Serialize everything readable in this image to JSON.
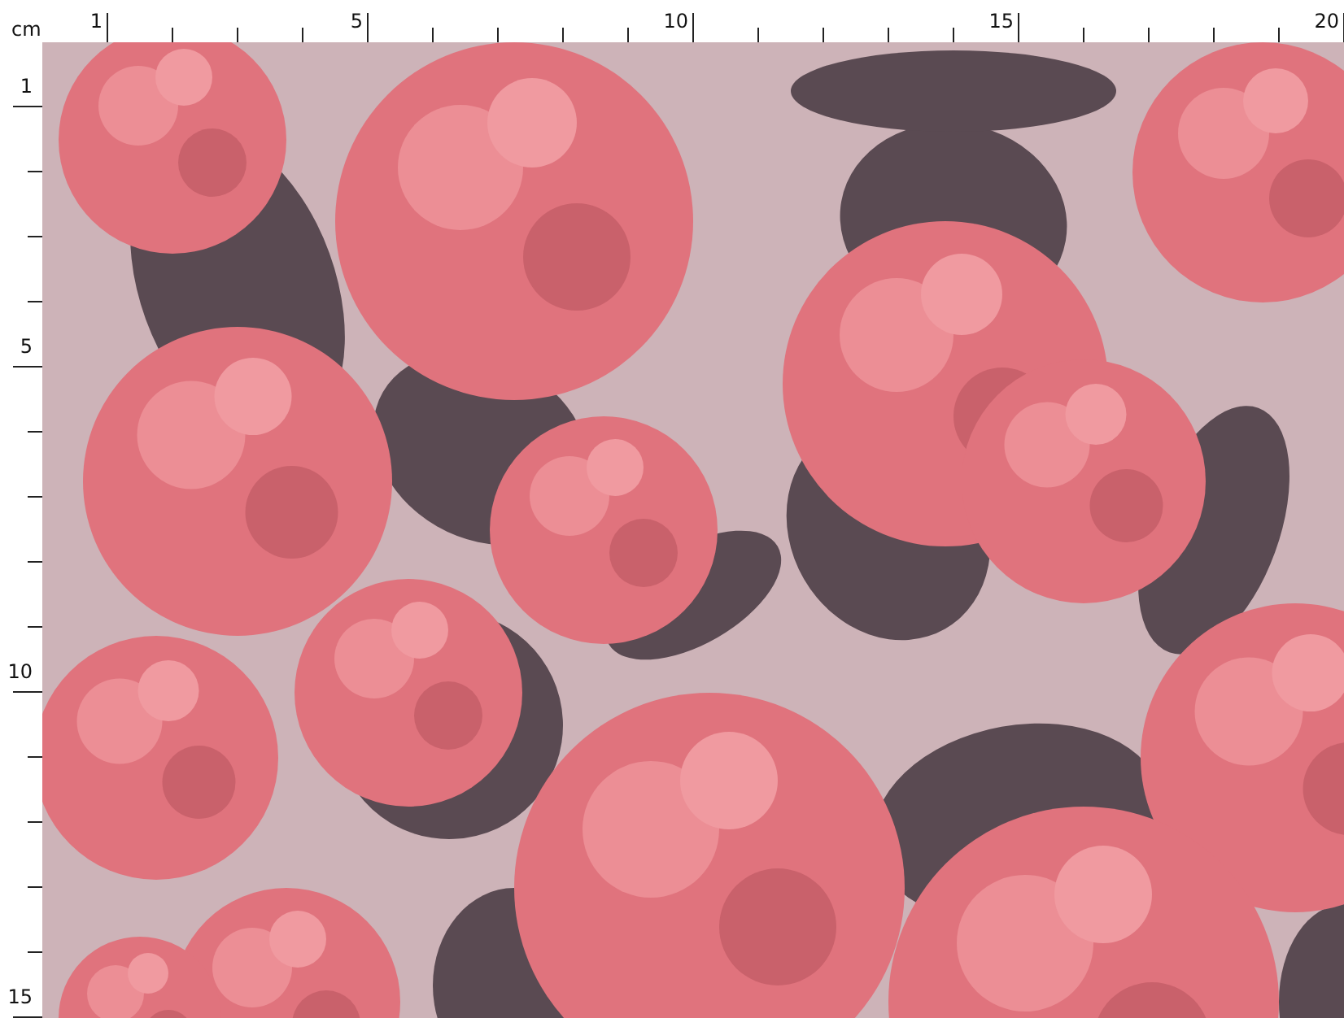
{
  "unit": "cm",
  "top_ruler": {
    "labels": [
      "1",
      "5",
      "10",
      "15",
      "20"
    ]
  },
  "left_ruler": {
    "labels": [
      "1",
      "5",
      "10",
      "15"
    ]
  }
}
